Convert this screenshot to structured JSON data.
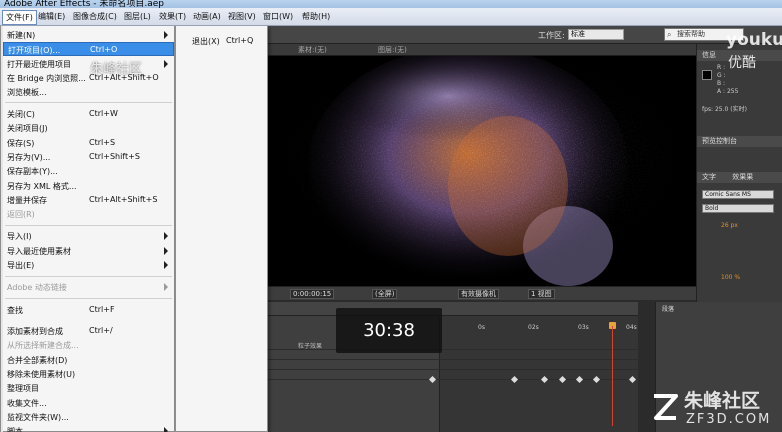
{
  "window": {
    "title": "Adobe After Effects - 未命名项目.aep"
  },
  "menubar": [
    {
      "label": "文件(F)",
      "active": true
    },
    {
      "label": "编辑(E)"
    },
    {
      "label": "图像合成(C)"
    },
    {
      "label": "图层(L)"
    },
    {
      "label": "效果(T)"
    },
    {
      "label": "动画(A)"
    },
    {
      "label": "视图(V)"
    },
    {
      "label": "窗口(W)"
    },
    {
      "label": "帮助(H)"
    }
  ],
  "toolbar": {
    "workspace_label": "工作区:",
    "workspace_value": "标准",
    "search_placeholder": "搜索帮助"
  },
  "panel_tabs": {
    "footage": "素材:(无)",
    "layer": "图层:(无)"
  },
  "viewer_controls": {
    "timecode": "0:00:00:15",
    "resolution": "(全屏)",
    "camera": "有效摄像机",
    "views": "1 视图"
  },
  "file_menu": {
    "items": [
      {
        "label": "新建(N)",
        "shortcut": "",
        "submenu": true
      },
      {
        "label": "打开项目(O)...",
        "shortcut": "Ctrl+O",
        "highlight": true
      },
      {
        "label": "打开最近使用项目",
        "shortcut": "",
        "submenu": true
      },
      {
        "label": "在 Bridge 内浏览照...",
        "shortcut": "Ctrl+Alt+Shift+O"
      },
      {
        "label": "浏览模板..."
      },
      {
        "sep": true
      },
      {
        "label": "关闭(C)",
        "shortcut": "Ctrl+W"
      },
      {
        "label": "关闭项目(J)"
      },
      {
        "label": "保存(S)",
        "shortcut": "Ctrl+S"
      },
      {
        "label": "另存为(V)...",
        "shortcut": "Ctrl+Shift+S"
      },
      {
        "label": "保存副本(Y)..."
      },
      {
        "label": "另存为 XML 格式..."
      },
      {
        "label": "增量并保存",
        "shortcut": "Ctrl+Alt+Shift+S"
      },
      {
        "label": "返回(R)",
        "disabled": true
      },
      {
        "sep": true
      },
      {
        "label": "导入(I)",
        "submenu": true
      },
      {
        "label": "导入最近使用素材",
        "submenu": true
      },
      {
        "label": "导出(E)",
        "submenu": true
      },
      {
        "sep": true
      },
      {
        "label": "Adobe 动态链接",
        "submenu": true,
        "disabled": true
      },
      {
        "sep": true
      },
      {
        "label": "查找",
        "shortcut": "Ctrl+F"
      },
      {
        "label": "添加素材到合成",
        "shortcut": "Ctrl+/"
      },
      {
        "label": "从所选择新建合成...",
        "disabled": true
      },
      {
        "label": "合并全部素材(D)"
      },
      {
        "label": "移除未使用素材(U)"
      },
      {
        "label": "整理项目"
      },
      {
        "label": "收集文件..."
      },
      {
        "label": "监视文件夹(W)..."
      },
      {
        "label": "脚本",
        "submenu": true
      }
    ]
  },
  "sub_menu": {
    "label": "退出(X)",
    "shortcut": "Ctrl+Q"
  },
  "right_panels": {
    "info_title": "信息",
    "rgba": [
      "R :",
      "G :",
      "B :",
      "A : 255"
    ],
    "fps": "fps: 25.0 (实时)",
    "preview_title": "预览控制台",
    "char_title": "文字",
    "effects_title": "效果果",
    "font": "Comic Sans MS",
    "style": "Bold",
    "size": "26 px",
    "scale": "100 %",
    "paragraph_title": "段落"
  },
  "timeline": {
    "ruler": [
      "0s",
      "02s",
      "03s",
      "04s"
    ],
    "layer": "粒子效果"
  },
  "overlay": {
    "time": "30:38"
  },
  "watermarks": {
    "top": "朱峰社区",
    "youku": "youku",
    "youku_sub": "优酷",
    "brand": "朱峰社区",
    "brand_url": "ZF3D.COM"
  }
}
